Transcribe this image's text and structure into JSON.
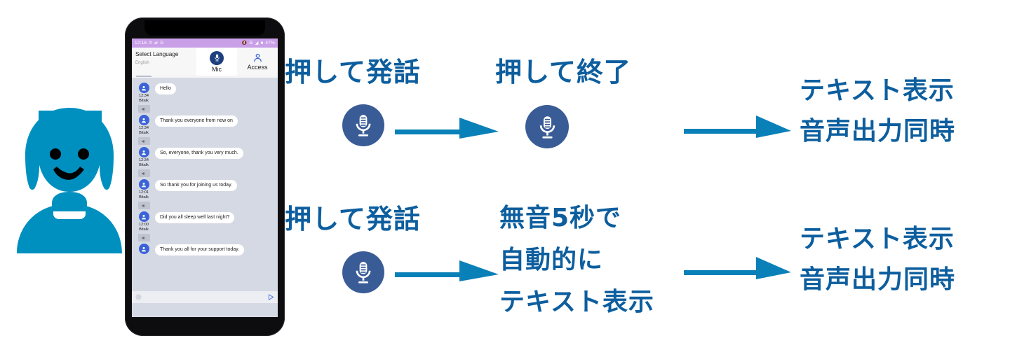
{
  "colors": {
    "accent_blue": "#0d5e9e",
    "arrow_blue": "#0a80b8",
    "avatar_cyan": "#0090c0",
    "mic_navy": "#3a5c96",
    "statusbar_purple": "#c9a0e8",
    "chat_background": "#d5d9e4",
    "chat_avatar_blue": "#3b63d8"
  },
  "speaker": {
    "icon": "woman-speaker-icon"
  },
  "phone": {
    "statusbar": {
      "time": "12:16",
      "battery": "47%",
      "left_icons": [
        "alarm-icon",
        "transfer-icon",
        "google-icon"
      ],
      "right_icons": [
        "mute-icon",
        "wifi-icon",
        "signal-icon",
        "battery-icon"
      ]
    },
    "nav": {
      "language_title": "Select Language",
      "language_value": "English",
      "mic_label": "Mic",
      "access_label": "Access"
    },
    "messages": [
      {
        "avatar": "person-avatar-icon",
        "text": "Hello",
        "time": "12:34",
        "sender": "Bitalk",
        "speaker_icon": "speaker-icon"
      },
      {
        "avatar": "person-avatar-icon",
        "text": "Thank you everyone from now on",
        "time": "12:34",
        "sender": "Bitalk",
        "speaker_icon": "speaker-icon"
      },
      {
        "avatar": "person-avatar-icon",
        "text": "So, everyone, thank you very much.",
        "time": "12:34",
        "sender": "Bitalk",
        "speaker_icon": "speaker-icon"
      },
      {
        "avatar": "person-avatar-icon",
        "text": "So thank you for joining us today.",
        "time": "12:01",
        "sender": "Bitalk",
        "speaker_icon": "speaker-icon"
      },
      {
        "avatar": "person-avatar-icon",
        "text": "Did you all sleep well last night?",
        "time": "12:00",
        "sender": "Bitalk",
        "speaker_icon": "speaker-icon"
      },
      {
        "avatar": "person-avatar-icon",
        "text": "Thank you all for your support today.",
        "time": "",
        "sender": "",
        "speaker_icon": ""
      }
    ],
    "input_bar": {
      "settings_icon": "gear-icon",
      "send_icon": "send-icon"
    }
  },
  "flow": {
    "row_top": {
      "step1_label": "押して発話",
      "step1_icon": "microphone-icon",
      "step2_label": "押して終了",
      "step2_icon": "microphone-icon",
      "arrow1": "arrow-right-icon",
      "arrow2": "arrow-right-icon",
      "result_line1": "テキスト表示",
      "result_line2": "音声出力同時"
    },
    "row_bottom": {
      "step1_label": "押して発話",
      "step1_icon": "microphone-icon",
      "step2_line1": "無音5秒で",
      "step2_line2": "自動的に",
      "step2_line3": "テキスト表示",
      "arrow1": "arrow-right-icon",
      "arrow2": "arrow-right-icon",
      "result_line1": "テキスト表示",
      "result_line2": "音声出力同時"
    }
  }
}
